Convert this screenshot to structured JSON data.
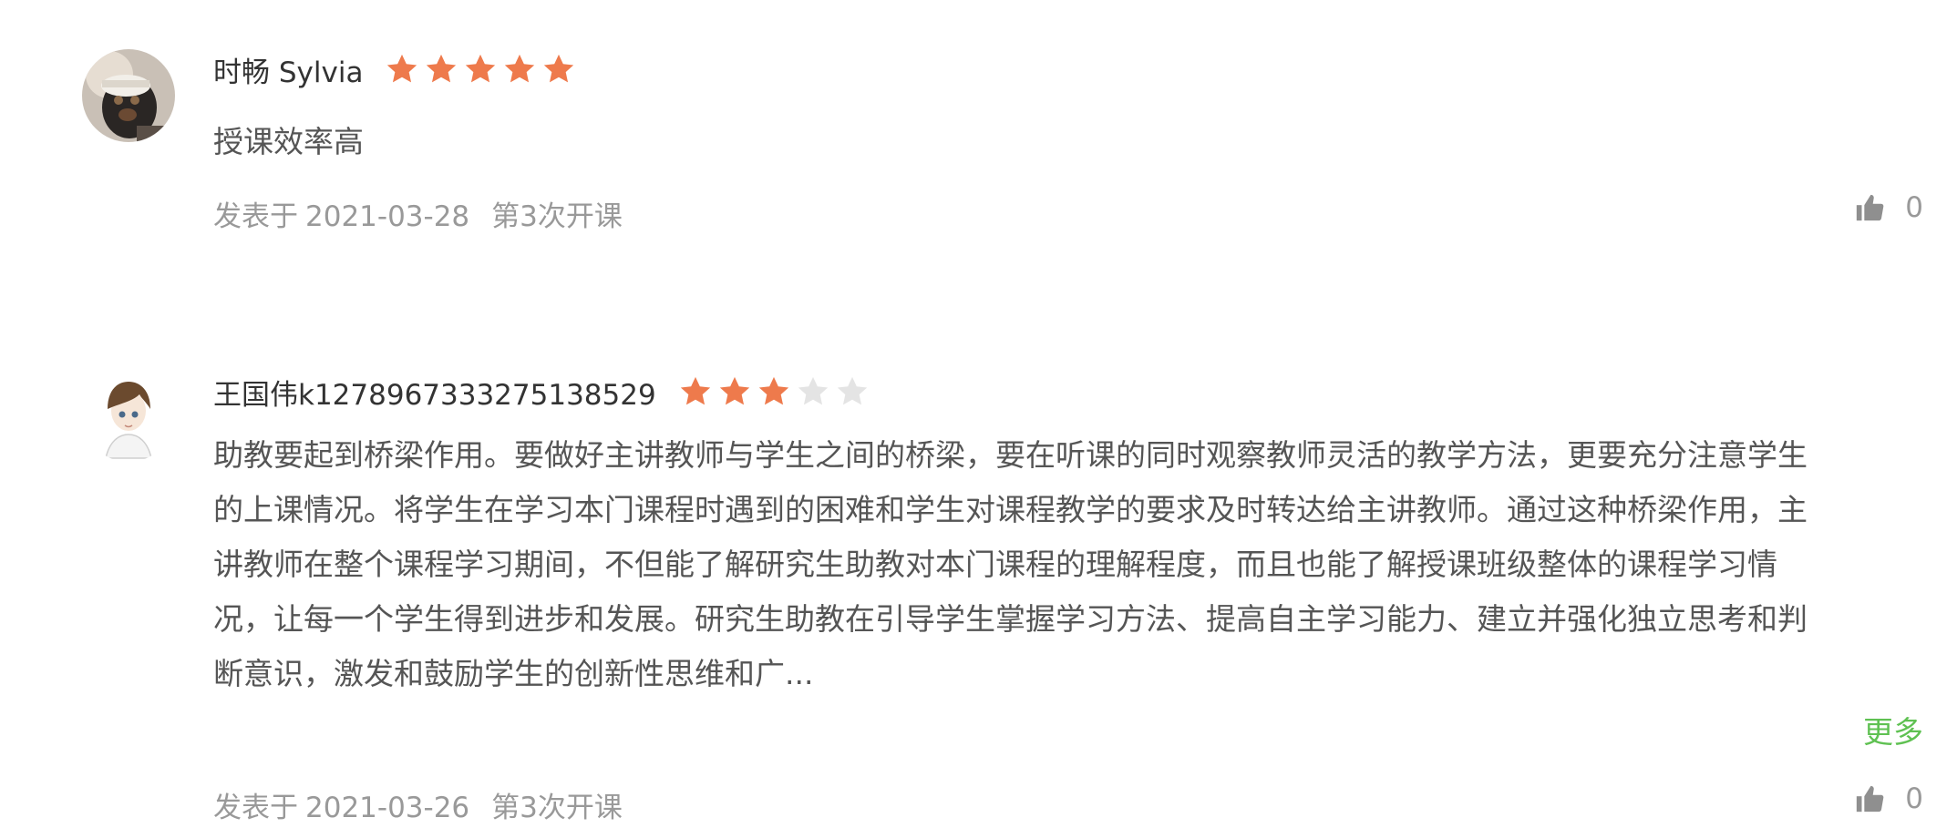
{
  "reviews": [
    {
      "username": "时畅 Sylvia",
      "rating": 5,
      "max_rating": 5,
      "content": "授课效率高",
      "date_prefix": "发表于",
      "date": "2021-03-28",
      "session": "第3次开课",
      "likes": "0"
    },
    {
      "username": "王国伟k1278967333275138529",
      "rating": 3,
      "max_rating": 5,
      "content": "助教要起到桥梁作用。要做好主讲教师与学生之间的桥梁，要在听课的同时观察教师灵活的教学方法，更要充分注意学生\n的上课情况。将学生在学习本门课程时遇到的困难和学生对课程教学的要求及时转达给主讲教师。通过这种桥梁作用，主\n讲教师在整个课程学习期间，不但能了解研究生助教对本门课程的理解程度，而且也能了解授课班级整体的课程学习情\n况，让每一个学生得到进步和发展。研究生助教在引导学生掌握学习方法、提高自主学习能力、建立并强化独立思考和判\n断意识，激发和鼓励学生的创新性思维和广...",
      "more_label": "更多",
      "date_prefix": "发表于",
      "date": "2021-03-26",
      "session": "第3次开课",
      "likes": "0"
    }
  ],
  "colors": {
    "star_filled": "#ee7a4c",
    "star_empty": "#e4e4e4",
    "more_link": "#5fc152",
    "meta_text": "#999999"
  },
  "icons": {
    "rating_star": "star-icon",
    "like": "thumbs-up-icon"
  }
}
